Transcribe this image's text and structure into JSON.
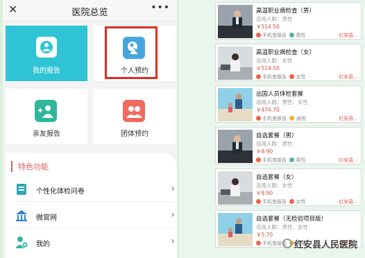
{
  "left_app": {
    "title": "医院总览",
    "close_icon": "close-icon",
    "more_icon": "more-icon",
    "tiles": [
      {
        "label": "我的报告",
        "icon": "user-report-icon",
        "bg": "#2fc4d5",
        "color": "#ffffff"
      },
      {
        "label": "个人预约",
        "icon": "personal-booking-icon",
        "bg": "#ffffff",
        "color": "#333333"
      },
      {
        "label": "亲友报告",
        "icon": "friends-report-icon",
        "bg": "#ffffff",
        "color": "#333333"
      },
      {
        "label": "团体预约",
        "icon": "group-booking-icon",
        "bg": "#ffffff",
        "color": "#333333"
      }
    ],
    "section_title": "特色功能",
    "rows": [
      {
        "label": "个性化体检问卷",
        "icon": "questionnaire-icon"
      },
      {
        "label": "微官网",
        "icon": "bank-icon"
      },
      {
        "label": "我的",
        "icon": "user-plus-icon"
      }
    ],
    "accent_color": "#e02b20"
  },
  "packages": [
    {
      "name": "高温职业病检查（男）",
      "audience": "适用人群：男性",
      "price": "￥514.50",
      "tag1": "手机查报告",
      "tag2": "男性",
      "location": "红安县..."
    },
    {
      "name": "高温职业病检查（女）",
      "audience": "适用人群：女性",
      "price": "￥514.50",
      "tag1": "手机查报告",
      "tag2": "女性",
      "location": "红安县..."
    },
    {
      "name": "出国人员体检套餐",
      "audience": "适用人群：男性、女性",
      "price": "￥474.70",
      "tag1": "手机查报告",
      "tag2": "通用",
      "location": "红安县..."
    },
    {
      "name": "自选套餐（男）",
      "audience": "适用人群：男性",
      "price": "￥8.90",
      "tag1": "手机查报告",
      "tag2": "男性",
      "location": "红安县..."
    },
    {
      "name": "自选套餐（女）",
      "audience": "适用人群：女性",
      "price": "￥8.90",
      "tag1": "手机查报告",
      "tag2": "女性",
      "location": "红安县..."
    },
    {
      "name": "自选套餐（无检验项目版）",
      "audience": "适用人群：男性、女性",
      "price": "￥5.70",
      "tag1": "手机查报告",
      "tag2": "通用",
      "location": "红安县..."
    }
  ],
  "watermark": "红安县人民医院"
}
